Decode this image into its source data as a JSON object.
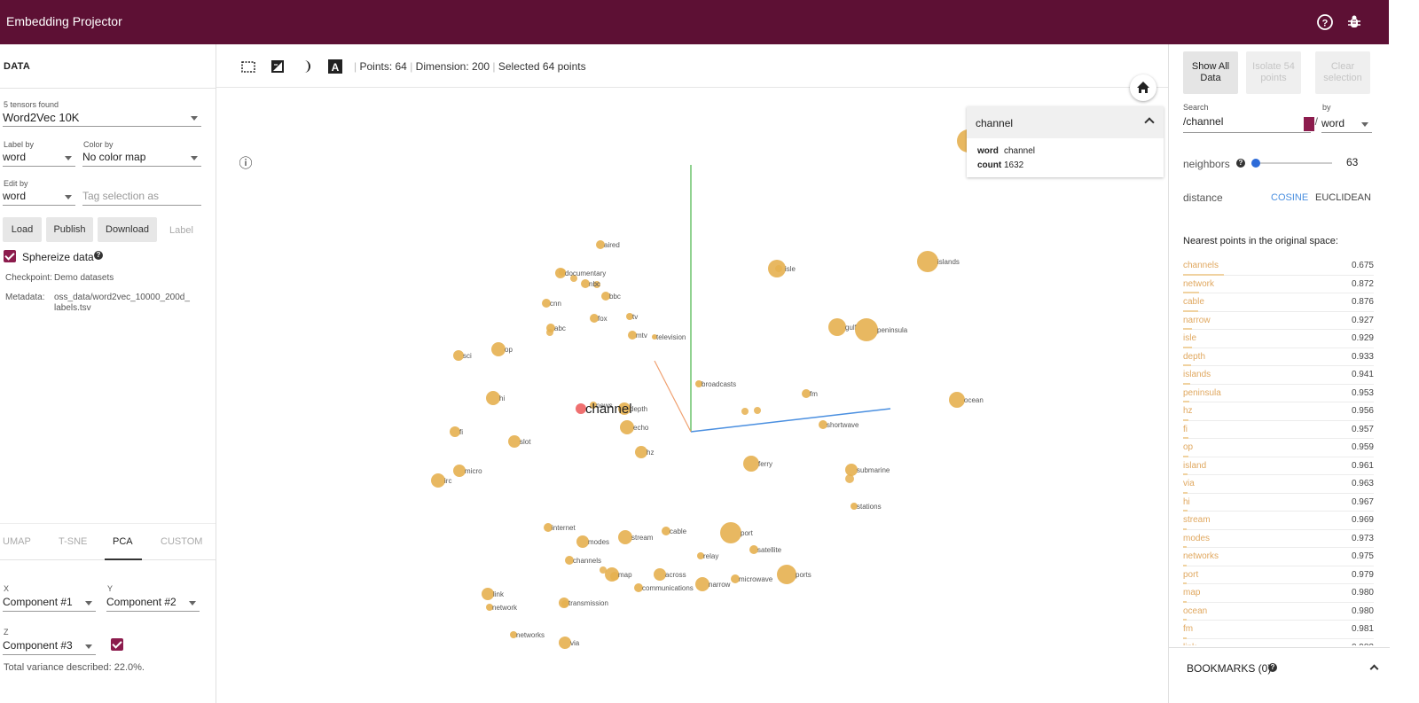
{
  "app": {
    "title": "Embedding Projector"
  },
  "data_panel": {
    "heading": "DATA",
    "tensors_found": "5 tensors found",
    "tensor": "Word2Vec 10K",
    "label_by_label": "Label by",
    "label_by_value": "word",
    "color_by_label": "Color by",
    "color_by_value": "No color map",
    "edit_by_label": "Edit by",
    "edit_by_value": "word",
    "tag_placeholder": "Tag selection as",
    "buttons": {
      "load": "Load",
      "publish": "Publish",
      "download": "Download",
      "label": "Label"
    },
    "sphereize": "Sphereize data",
    "checkpoint_label": "Checkpoint:",
    "checkpoint_value": "Demo datasets",
    "metadata_label": "Metadata:",
    "metadata_value_1": "oss_data/word2vec_10000_200d_",
    "metadata_value_2": "labels.tsv"
  },
  "projection": {
    "tabs": [
      "UMAP",
      "T-SNE",
      "PCA",
      "CUSTOM"
    ],
    "active_tab": "PCA",
    "x_label": "X",
    "x_value": "Component #1",
    "y_label": "Y",
    "y_value": "Component #2",
    "z_label": "Z",
    "z_value": "Component #3",
    "variance": "Total variance described: 22.0%."
  },
  "toolbar": {
    "points": "Points: 64",
    "dimension": "Dimension: 200",
    "selected": "Selected 64 points"
  },
  "inspect_card": {
    "title": "channel",
    "word_key": "word",
    "word_value": "channel",
    "count_key": "count",
    "count_value": "1632"
  },
  "right_panel": {
    "show_all": "Show All Data",
    "isolate": "Isolate 54 points",
    "clear": "Clear selection",
    "search_label": "Search",
    "search_value": "/channel",
    "regex_glyph": "/",
    "by_label": "by",
    "by_value": "word",
    "neighbors_label": "neighbors",
    "neighbors_value": "63",
    "neighbors_fraction": 0.63,
    "distance_label": "distance",
    "cosine": "COSINE",
    "euclidean": "EUCLIDEAN",
    "nearest_title": "Nearest points in the original space:",
    "nearest": [
      {
        "word": "channels",
        "value": "0.675"
      },
      {
        "word": "network",
        "value": "0.872"
      },
      {
        "word": "cable",
        "value": "0.876"
      },
      {
        "word": "narrow",
        "value": "0.927"
      },
      {
        "word": "isle",
        "value": "0.929"
      },
      {
        "word": "depth",
        "value": "0.933"
      },
      {
        "word": "islands",
        "value": "0.941"
      },
      {
        "word": "peninsula",
        "value": "0.953"
      },
      {
        "word": "hz",
        "value": "0.956"
      },
      {
        "word": "fi",
        "value": "0.957"
      },
      {
        "word": "op",
        "value": "0.959"
      },
      {
        "word": "island",
        "value": "0.961"
      },
      {
        "word": "via",
        "value": "0.963"
      },
      {
        "word": "hi",
        "value": "0.967"
      },
      {
        "word": "stream",
        "value": "0.969"
      },
      {
        "word": "modes",
        "value": "0.973"
      },
      {
        "word": "networks",
        "value": "0.975"
      },
      {
        "word": "port",
        "value": "0.979"
      },
      {
        "word": "map",
        "value": "0.980"
      },
      {
        "word": "ocean",
        "value": "0.980"
      },
      {
        "word": "fm",
        "value": "0.981"
      },
      {
        "word": "link",
        "value": "0.982"
      }
    ],
    "bookmarks": "BOOKMARKS (0)"
  },
  "scatter": {
    "selected_label": "channel",
    "labels": [
      "aired",
      "documentary",
      "nbc",
      "bbc",
      "cnn",
      "fox",
      "tv",
      "abc",
      "mtv",
      "television",
      "op",
      "sci",
      "hi",
      "news",
      "depth",
      "echo",
      "fi",
      "slot",
      "hz",
      "micro",
      "irc",
      "broadcasts",
      "fm",
      "shortwave",
      "isle",
      "islands",
      "gulf",
      "peninsula",
      "island",
      "ocean",
      "ferry",
      "submarine",
      "stations",
      "internet",
      "modes",
      "stream",
      "cable",
      "port",
      "satellite",
      "channels",
      "relay",
      "map",
      "across",
      "narrow",
      "microwave",
      "ports",
      "communications",
      "link",
      "transmission",
      "network",
      "networks",
      "via"
    ]
  },
  "colors": {
    "brand": "#5d1034",
    "point": "#e6b050",
    "selected": "#ef7070",
    "accent": "#4a8fe0",
    "checkbox": "#8c1c4d"
  }
}
